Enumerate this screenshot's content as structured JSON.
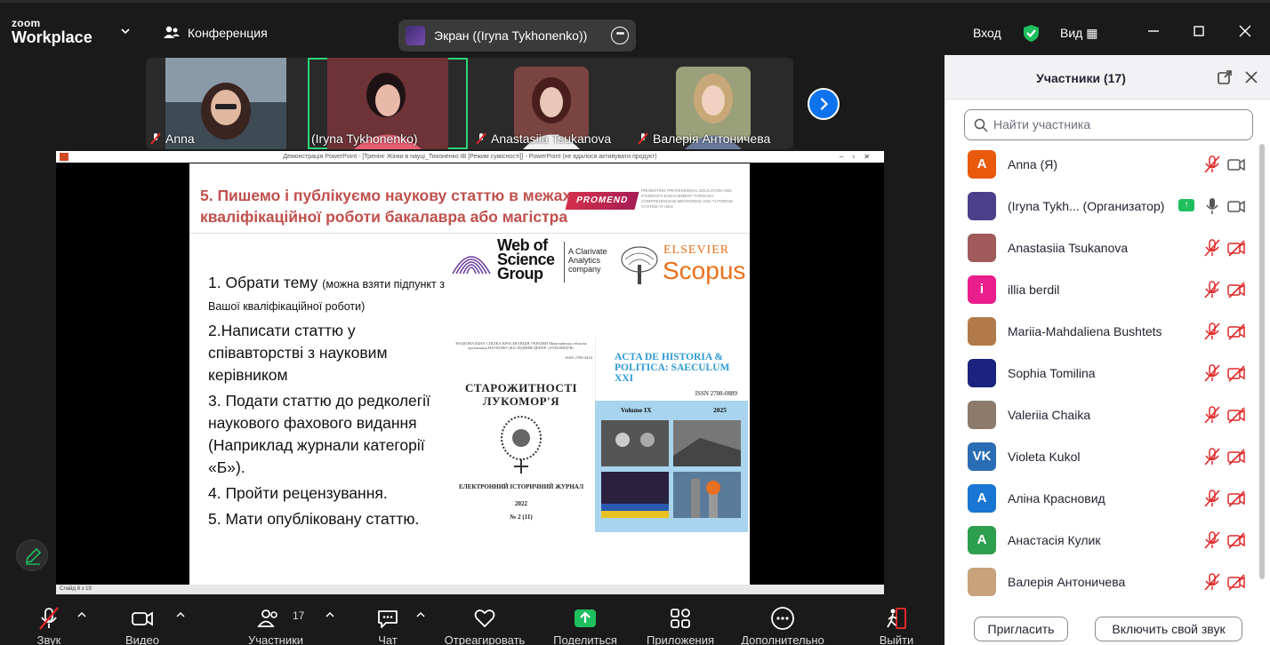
{
  "app": {
    "brand_top": "zoom",
    "brand_bottom": "Workplace",
    "meeting_label": "Конференция"
  },
  "screen_share": {
    "label": "Экран ((Iryna Tykhonenko))"
  },
  "top_right": {
    "signin": "Вход",
    "view": "Вид"
  },
  "video_strip": [
    {
      "name": "Anna",
      "muted": true
    },
    {
      "name": "(Iryna Tykhonenko)",
      "muted": false,
      "active": true
    },
    {
      "name": "Anastasiia Tsukanova",
      "muted": true
    },
    {
      "name": "Валерія Антоничева",
      "muted": true
    }
  ],
  "ppt": {
    "window_title": "Демонстрація PowerPoint - [Тренінг Жінки в науці_Тихоненко ІВ [Режим сумісності]] - PowerPoint (не вдалося активувати продукт)",
    "status": "Слайд 8 з 19",
    "slide": {
      "title": "5. Пишемо і публікуємо наукову статтю в межах кваліфікаційної роботи бакалавра або магістра",
      "promo_badge": "PROMEND",
      "promo_text": "PROMOTING PROFESSIONAL EDUCATION AND STUDENTS ENGAGEMENT THROUGH COMPREHENSIVE MENTORING AND TUTORING SYSTEM AT HEIs",
      "wos_text": "Web of Science Group",
      "clarivate_text": "A Clarivate Analytics company",
      "elsevier": "ELSEVIER",
      "scopus": "Scopus",
      "items": [
        {
          "main": "1. Обрати тему ",
          "note": "(можна взяти підпункт з Вашої кваліфікаційної роботи)"
        },
        {
          "main": "2.Написати статтю у співавторстві з науковим керівником",
          "note": ""
        },
        {
          "main": "3. Подати статтю до редколегії наукового фахового видання (Наприклад журнали категорії «Б»).",
          "note": ""
        },
        {
          "main": "4. Пройти рецензування.",
          "note": ""
        },
        {
          "main": "5. Мати опубліковану статтю.",
          "note": ""
        }
      ],
      "journal1": {
        "header": "НАЦІОНАЛЬНА СПІЛКА КРАЄЗНАВЦІВ УКРАЇНИ Миколаївська обласна організація НАУКОВО-ДОСЛІДНИЙ ЦЕНТР «ЛУКОМОР'Я»",
        "issn": "ISSN 2708-4434",
        "title": "СТАРОЖИТНОСТІ ЛУКОМОР'Я",
        "subtitle": "ЕЛЕКТРОННИЙ ІСТОРИЧНИЙ ЖУРНАЛ",
        "year": "2022",
        "number": "№ 2 (11)"
      },
      "journal2": {
        "title": "ACTA DE HISTORIA & POLITICA: SAECULUM XXI",
        "issn": "ISSN 2708-0889",
        "volume": "Volume IX",
        "year": "2025"
      }
    }
  },
  "toolbar": {
    "audio": "Звук",
    "video": "Видео",
    "participants": "Участники",
    "participants_count": "17",
    "chat": "Чат",
    "react": "Отреагировать",
    "share": "Поделиться",
    "apps": "Приложения",
    "more": "Дополнительно",
    "leave": "Выйти"
  },
  "panel": {
    "title": "Участники (17)",
    "search_placeholder": "Найти участника",
    "participants": [
      {
        "name": "Anna (Я)",
        "initial": "A",
        "color": "#e8590c",
        "mic": "muted",
        "cam": "on"
      },
      {
        "name": "(Iryna Tykh...  (Организатор)",
        "initial": "",
        "color": "#4b3f8a",
        "mic": "on",
        "cam": "on",
        "sharing": true
      },
      {
        "name": "Anastasiia Tsukanova",
        "initial": "",
        "color": "#a05a5a",
        "mic": "muted",
        "cam": "off"
      },
      {
        "name": "illia berdil",
        "initial": "i",
        "color": "#e91e8c",
        "mic": "muted",
        "cam": "off"
      },
      {
        "name": "Mariia-Mahdaliena Bushtets",
        "initial": "",
        "color": "#b07a4a",
        "mic": "muted",
        "cam": "off"
      },
      {
        "name": "Sophia Tomilina",
        "initial": "",
        "color": "#1a237e",
        "mic": "muted",
        "cam": "off"
      },
      {
        "name": "Valeriia Chaika",
        "initial": "",
        "color": "#8d7a6a",
        "mic": "muted",
        "cam": "off"
      },
      {
        "name": "Violeta Kukol",
        "initial": "VK",
        "color": "#2a6db5",
        "mic": "muted",
        "cam": "off"
      },
      {
        "name": "Аліна Красновид",
        "initial": "A",
        "color": "#1976d2",
        "mic": "muted",
        "cam": "off"
      },
      {
        "name": "Анастасія Кулик",
        "initial": "A",
        "color": "#2e9e4f",
        "mic": "muted",
        "cam": "off"
      },
      {
        "name": "Валерія Антоничева",
        "initial": "",
        "color": "#c7a27a",
        "mic": "muted",
        "cam": "off"
      }
    ],
    "invite": "Пригласить",
    "unmute_self": "Включить свой звук"
  },
  "colors": {
    "accent": "#0e72ed",
    "muted_red": "#e02828",
    "share_green": "#1fbe5f"
  }
}
